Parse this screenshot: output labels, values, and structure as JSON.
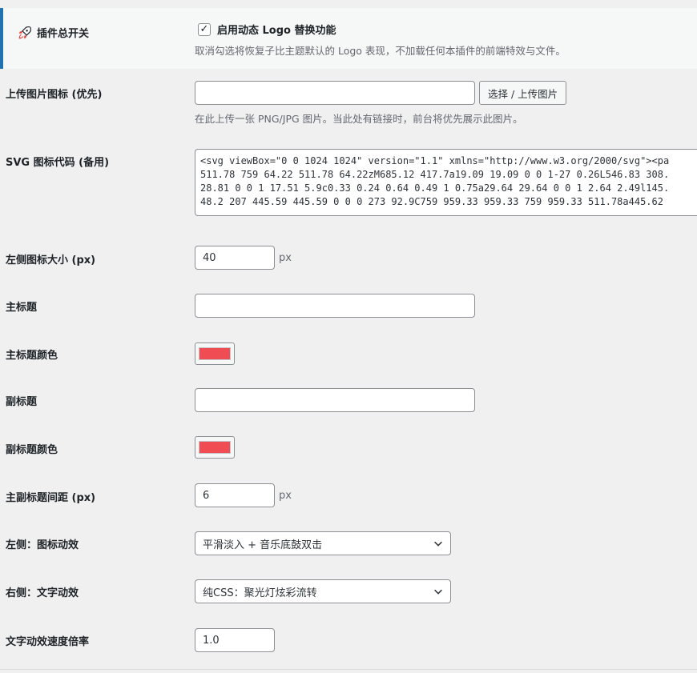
{
  "master": {
    "label": "插件总开关",
    "checkbox_label": "启用动态 Logo 替换功能",
    "description": "取消勾选将恢复子比主题默认的 Logo 表现，不加载任何本插件的前端特效与文件。"
  },
  "upload": {
    "label": "上传图片图标 (优先)",
    "value": "",
    "button_label": "选择 / 上传图片",
    "description": "在此上传一张 PNG/JPG 图片。当此处有链接时，前台将优先展示此图片。"
  },
  "svg": {
    "label": "SVG 图标代码 (备用)",
    "lines": [
      "<svg viewBox=\"0 0 1024 1024\" version=\"1.1\" xmlns=\"http://www.w3.org/2000/svg\"><pa",
      "511.78 759 64.22 511.78 64.22zM685.12 417.7a19.09 19.09 0 0 1-27 0.26L546.83 308.",
      "28.81 0 0 1 17.51 5.9c0.33 0.24 0.64 0.49 1 0.75a29.64 29.64 0 0 1 2.64 2.49l145.",
      "48.2 207 445.59 445.59 0 0 0 273 92.9C759 959.33 959.33 759 959.33 511.78a445.62"
    ]
  },
  "icon_size": {
    "label": "左侧图标大小 (px)",
    "value": "40",
    "unit": "px"
  },
  "main_title": {
    "label": "主标题",
    "value": ""
  },
  "main_title_color": {
    "label": "主标题颜色",
    "color": "#f04c54"
  },
  "subtitle": {
    "label": "副标题",
    "value": ""
  },
  "subtitle_color": {
    "label": "副标题颜色",
    "color": "#f04c54"
  },
  "spacing": {
    "label": "主副标题间距 (px)",
    "value": "6",
    "unit": "px"
  },
  "icon_effect": {
    "label": "左侧：图标动效",
    "selected": "平滑淡入 + 音乐底鼓双击"
  },
  "text_effect": {
    "label": "右侧：文字动效",
    "selected": "纯CSS：聚光灯炫彩流转"
  },
  "speed": {
    "label": "文字动效速度倍率",
    "value": "1.0"
  },
  "icons": {
    "master": "rocket-icon",
    "select": "chevron-down-icon"
  },
  "colors": {
    "accent": "#2271b1",
    "rocket": "#e0453a"
  }
}
